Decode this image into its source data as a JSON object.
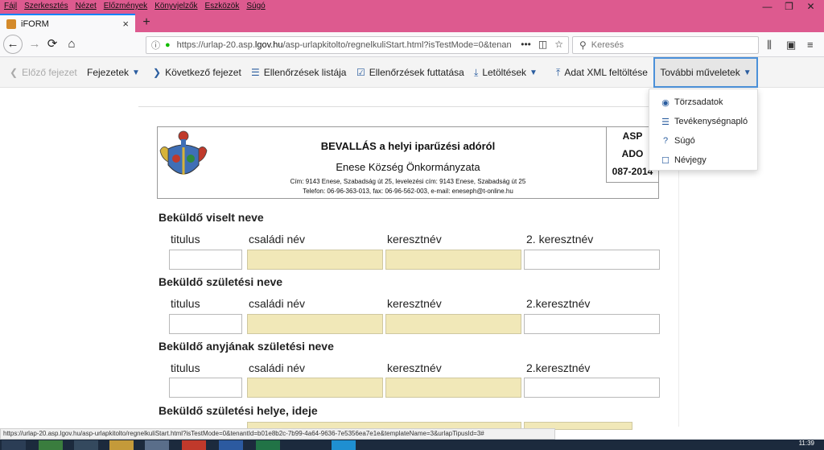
{
  "menu": [
    "Fájl",
    "Szerkesztés",
    "Nézet",
    "Előzmények",
    "Könyvjelzők",
    "Eszközök",
    "Súgó"
  ],
  "window_controls": {
    "minimize": "—",
    "restore": "❐",
    "close": "✕"
  },
  "tab": {
    "title": "iFORM",
    "close": "×",
    "new_tab": "+"
  },
  "navbar": {
    "back": "←",
    "forward": "→",
    "reload": "⟳",
    "home": "⌂",
    "info_icon": "ⓘ",
    "lock_icon": "🔒",
    "url_prefix": "https://urlap-20.asp.",
    "url_domain": "lgov.hu",
    "url_rest": "/asp-urlapkitolto/regnelkuliStart.html?isTestMode=0&tenan",
    "url_actions": [
      "•••",
      "◫",
      "☆"
    ],
    "search_placeholder": "Keresés",
    "right_tools": [
      "⫼",
      "▣",
      "≡"
    ]
  },
  "toolbar": {
    "prev": "Előző fejezet",
    "chapters": "Fejezetek",
    "next": "Következő fejezet",
    "checklist": "Ellenőrzések listája",
    "run_checks": "Ellenőrzések futtatása",
    "downloads": "Letöltések",
    "upload_xml": "Adat XML feltöltése",
    "more": "További műveletek"
  },
  "dropdown": {
    "items": [
      {
        "label": "Törzsadatok",
        "icon": "user-circle-icon"
      },
      {
        "label": "Tevékenységnapló",
        "icon": "list-icon"
      },
      {
        "label": "Súgó",
        "icon": "question-circle-icon"
      },
      {
        "label": "Névjegy",
        "icon": "card-icon"
      }
    ]
  },
  "header": {
    "title": "BEVALLÁS a helyi iparűzési adóról",
    "office": "Enese Község Önkormányzata",
    "address": "Cím: 9143 Enese, Szabadság út 25, levelezési cím: 9143 Enese, Szabadság út 25",
    "phone": "Telefon: 06-96-363-013, fax: 06-96-562-003, e-mail: eneseph@t-online.hu",
    "code1": "ASP",
    "code2": "ADO",
    "code3": "087-2014"
  },
  "sections": [
    {
      "title": "Beküldő viselt neve",
      "labels": [
        "titulus",
        "családi név",
        "keresztnév",
        "2. keresztnév"
      ]
    },
    {
      "title": "Beküldő születési neve",
      "labels": [
        "titulus",
        "családi név",
        "keresztnév",
        "2.keresztnév"
      ]
    },
    {
      "title": "Beküldő anyjának születési neve",
      "labels": [
        "titulus",
        "családi név",
        "keresztnév",
        "2.keresztnév"
      ]
    },
    {
      "title": "Beküldő születési helye, ideje"
    }
  ],
  "statusbar": "https://urlap-20.asp.lgov.hu/asp-urlapkitolto/regnelkuliStart.html?isTestMode=0&tenantId=b01e8b2c-7b99-4a64-9636-7e5356ea7e1e&templateName=3&urlapTipusId=3#",
  "clock": "11:39",
  "colors": {
    "titlebar": "#dd5a8f",
    "accent": "#2a5d9f",
    "required_field": "#f1e8b8",
    "more_border": "#4a90d9"
  }
}
